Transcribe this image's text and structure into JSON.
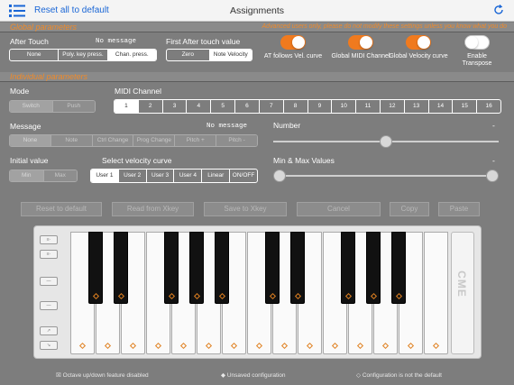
{
  "topbar": {
    "reset_label": "Reset all to default",
    "title": "Assignments"
  },
  "global": {
    "header": "Global parameters",
    "notice": "Advanced users only, please do not modify these settings unless you know what you do",
    "aftertouch": {
      "label": "After Touch",
      "value": "No message",
      "options": [
        "None",
        "Poly. key press.",
        "Chan. press."
      ],
      "selected": 2
    },
    "first_at": {
      "label": "First After touch value",
      "options": [
        "Zero",
        "Note Velocity"
      ],
      "selected": 1
    },
    "toggles": [
      {
        "label": "AT follows Vel. curve",
        "on": true
      },
      {
        "label": "Global MIDI Channel",
        "on": true
      },
      {
        "label": "Global Velocity curve",
        "on": true
      },
      {
        "label": "Enable Transpose",
        "on": false
      }
    ]
  },
  "individual": {
    "header": "Individual parameters",
    "mode": {
      "label": "Mode",
      "options": [
        "Switch",
        "Push"
      ],
      "selected": 0
    },
    "midi": {
      "label": "MIDI Channel",
      "channels": [
        "1",
        "2",
        "3",
        "4",
        "5",
        "6",
        "7",
        "8",
        "9",
        "10",
        "11",
        "12",
        "13",
        "14",
        "15",
        "16"
      ],
      "selected": 0
    },
    "message": {
      "label": "Message",
      "value": "No message",
      "options": [
        "None",
        "Note",
        "Ctrl Change",
        "Prog Change",
        "Pitch +",
        "Pitch -"
      ],
      "selected": 0
    },
    "number": {
      "label": "Number",
      "value": "-",
      "level": 0.5
    },
    "initial": {
      "label": "Initial value",
      "options": [
        "Min",
        "Max"
      ],
      "selected": 0
    },
    "velocity": {
      "label": "Select velocity curve",
      "options": [
        "User 1",
        "User 2",
        "User 3",
        "User 4",
        "Linear",
        "ON/OFF"
      ],
      "selected": 0
    },
    "minmax": {
      "label": "Min & Max Values",
      "value": "-",
      "min_level": 0.0,
      "max_level": 1.0
    }
  },
  "actions": [
    "Reset to default",
    "Read from Xkey",
    "Save to Xkey",
    "Cancel",
    "Copy",
    "Paste"
  ],
  "keyboard": {
    "logo": "CME"
  },
  "footer": {
    "octave": "Octave up/down feature disabled",
    "unsaved": "Unsaved configuration",
    "notdefault": "Configuration is not the default"
  },
  "colors": {
    "accent": "#f07a1e",
    "link": "#1a66d6",
    "background": "#7d7d7d"
  }
}
